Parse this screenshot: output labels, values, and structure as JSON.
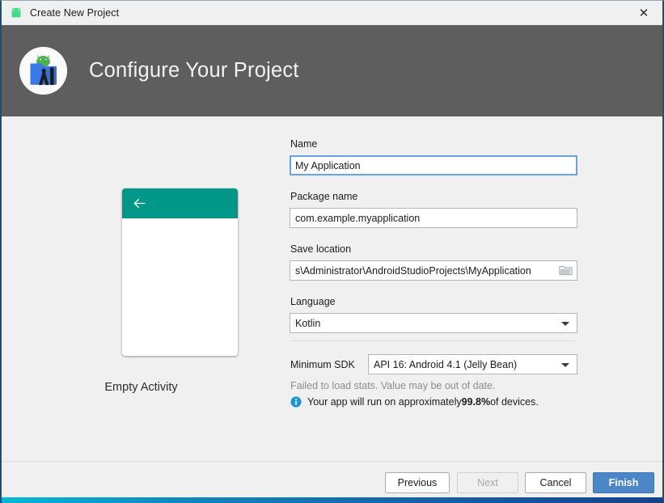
{
  "window": {
    "title": "Create New Project",
    "title_icon": "android-robot-icon",
    "close_icon": "close-icon"
  },
  "header": {
    "title": "Configure Your Project",
    "logo_icon": "android-studio-logo-icon",
    "background_color": "#5e5e5e"
  },
  "preview": {
    "caption": "Empty Activity",
    "appbar_color": "#009688",
    "back_icon": "back-arrow-icon"
  },
  "form": {
    "name": {
      "label": "Name",
      "value": "My Application",
      "focused": true
    },
    "package_name": {
      "label": "Package name",
      "value": "com.example.myapplication"
    },
    "save_location": {
      "label": "Save location",
      "value": "s\\Administrator\\AndroidStudioProjects\\MyApplication",
      "browse_icon": "folder-icon"
    },
    "language": {
      "label": "Language",
      "value": "Kotlin",
      "dropdown_icon": "chevron-down-icon"
    },
    "minimum_sdk": {
      "label": "Minimum SDK",
      "value": "API 16: Android 4.1 (Jelly Bean)",
      "dropdown_icon": "chevron-down-icon"
    },
    "sdk_warning": "Failed to load stats. Value may be out of date.",
    "sdk_info": {
      "icon": "info-icon",
      "prefix": "Your app will run on approximately ",
      "percent": "99.8%",
      "suffix": " of devices.",
      "icon_color": "#2196d4"
    }
  },
  "footer": {
    "previous_label": "Previous",
    "next_label": "Next",
    "cancel_label": "Cancel",
    "finish_label": "Finish",
    "finish_color": "#4a86c8"
  }
}
